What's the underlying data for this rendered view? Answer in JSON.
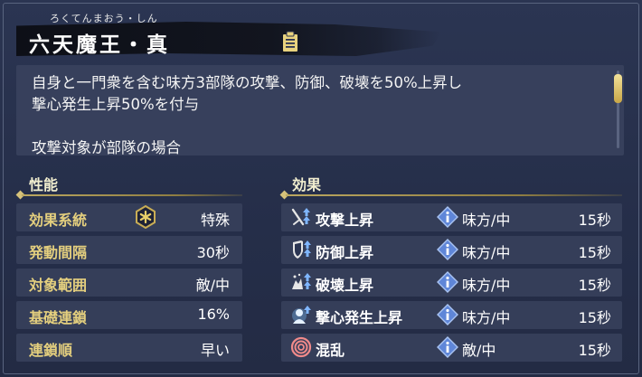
{
  "skill": {
    "reading": "ろくてんまおう・しん",
    "title": "六天魔王・真",
    "icon": "notes-icon"
  },
  "description": {
    "text": "自身と一門衆を含む味方3部隊の攻撃、防御、破壊を50%上昇し\n撃心発生上昇50%を付与\n\n攻撃対象が部隊の場合"
  },
  "sections": {
    "stats_label": "性能",
    "effects_label": "効果"
  },
  "stats": [
    {
      "label": "効果系統",
      "value": "特殊",
      "icon": "special-type-icon"
    },
    {
      "label": "発動間隔",
      "value": "30秒"
    },
    {
      "label": "対象範囲",
      "value": "敵/中"
    },
    {
      "label": "基礎連鎖",
      "value": "16%"
    },
    {
      "label": "連鎖順",
      "value": "早い"
    }
  ],
  "effects": [
    {
      "name": "攻撃上昇",
      "target": "味方/中",
      "duration": "15秒",
      "icon": "attack-up-icon"
    },
    {
      "name": "防御上昇",
      "target": "味方/中",
      "duration": "15秒",
      "icon": "defense-up-icon"
    },
    {
      "name": "破壊上昇",
      "target": "味方/中",
      "duration": "15秒",
      "icon": "destruction-up-icon"
    },
    {
      "name": "撃心発生上昇",
      "target": "味方/中",
      "duration": "15秒",
      "icon": "critical-up-icon"
    },
    {
      "name": "混乱",
      "target": "敵/中",
      "duration": "15秒",
      "icon": "confusion-icon"
    }
  ],
  "colors": {
    "label_gold": "#e4cf7e",
    "row_bg": "#353e59",
    "panel_bg": "#37405c",
    "info_blue": "#5f86d8"
  }
}
